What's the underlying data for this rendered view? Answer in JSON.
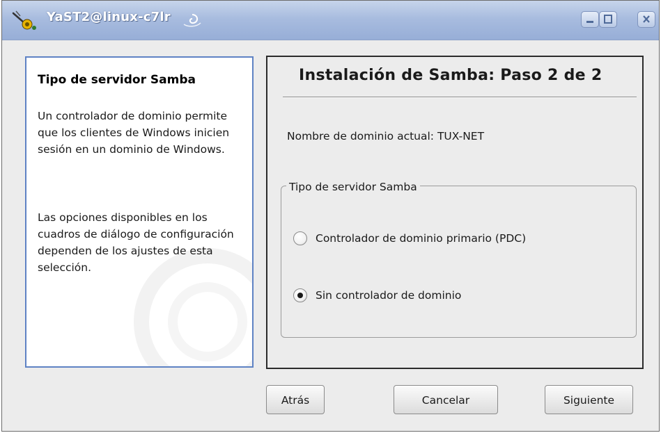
{
  "window": {
    "title": "YaST2@linux-c7lr"
  },
  "help": {
    "title": "Tipo de servidor Samba",
    "paragraph1": "Un controlador de dominio permite que los clientes de Windows inicien sesión en un dominio de Windows.",
    "paragraph2": "Las opciones disponibles en los cuadros de diálogo de configuración dependen de los ajustes de esta selección."
  },
  "main": {
    "heading": "Instalación de Samba: Paso 2 de 2",
    "domain_label": "Nombre de dominio actual: TUX-NET",
    "group": {
      "legend": "Tipo de servidor Samba",
      "options": [
        {
          "label": "Controlador de dominio primario (PDC)",
          "selected": false
        },
        {
          "label": "Sin controlador de dominio",
          "selected": true
        }
      ]
    }
  },
  "buttons": {
    "back": "Atrás",
    "cancel": "Cancelar",
    "next": "Siguiente"
  },
  "icons": {
    "app": "yast-app-icon",
    "title_decoration": "swirl-icon",
    "minimize": "minimize-icon",
    "maximize": "maximize-icon",
    "close": "close-icon"
  }
}
